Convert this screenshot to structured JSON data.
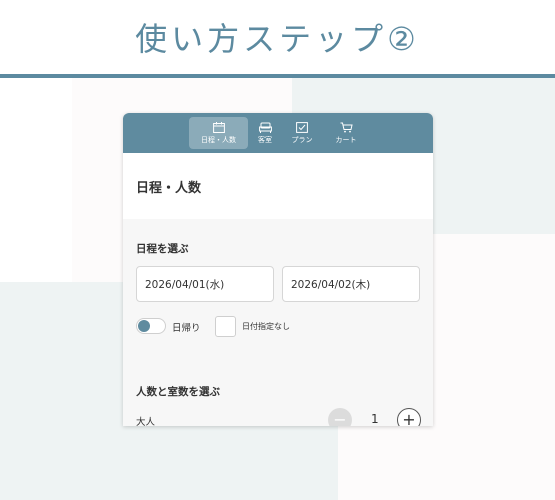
{
  "heading": {
    "title": "使い方ステップ②"
  },
  "app": {
    "nav_tabs": [
      {
        "label": "日程・人数",
        "icon": "calendar-icon",
        "active": true
      },
      {
        "label": "客室",
        "icon": "bed-icon",
        "active": false
      },
      {
        "label": "プラン",
        "icon": "checklist-icon",
        "active": false
      },
      {
        "label": "カート",
        "icon": "cart-icon",
        "active": false
      }
    ],
    "page_title": "日程・人数",
    "date_section": {
      "title": "日程を選ぶ",
      "checkin": "2026/04/01(水)",
      "checkout": "2026/04/02(木)",
      "day_trip_label": "日帰り",
      "day_trip_on": true,
      "no_date_label": "日付指定なし",
      "no_date_checked": false
    },
    "guest_section": {
      "title": "人数と室数を選ぶ",
      "adult_label": "大人",
      "adult_count": "1",
      "minus_symbol": "−",
      "plus_symbol": "+"
    }
  },
  "colors": {
    "accent": "#5c8aa0",
    "topbar": "#5f8b9f",
    "panel_bg": "#f7f7f7",
    "block_bg": "#eef3f3"
  }
}
